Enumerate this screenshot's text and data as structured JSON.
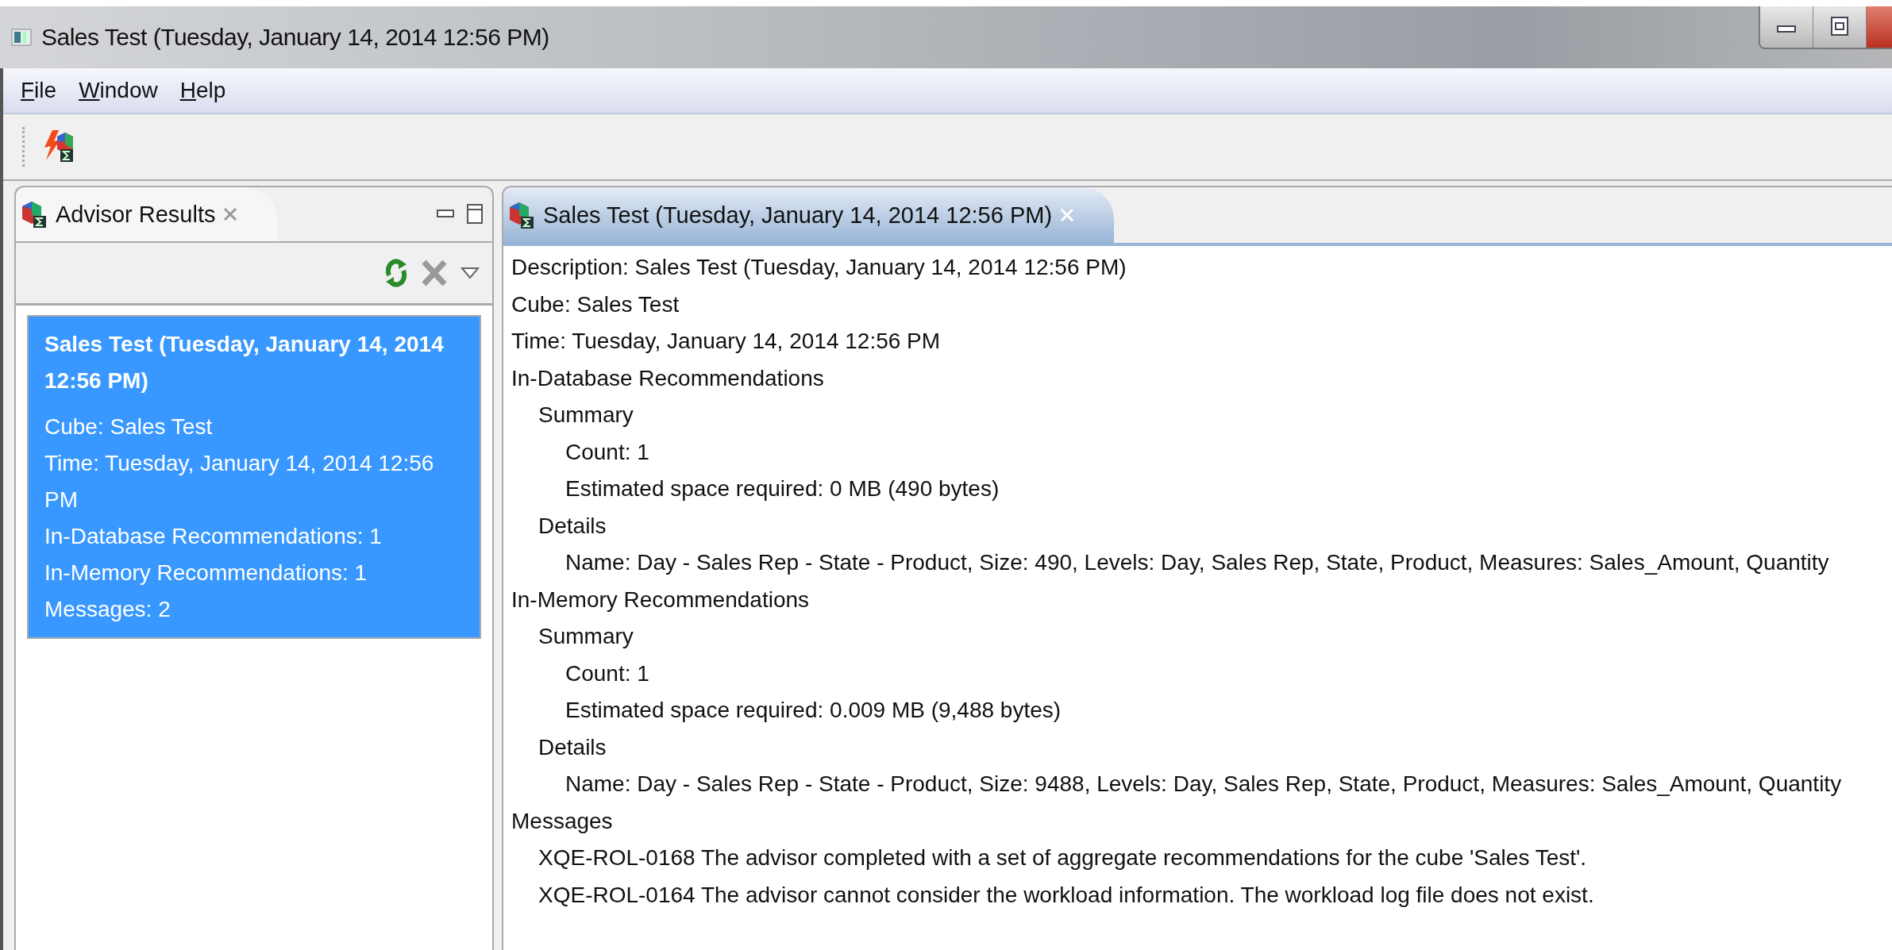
{
  "window": {
    "title": "Sales Test (Tuesday, January 14, 2014 12:56 PM)"
  },
  "menu": [
    {
      "label": "File"
    },
    {
      "label": "Window"
    },
    {
      "label": "Help"
    }
  ],
  "left_panel": {
    "tab": {
      "label": "Advisor Results",
      "selected": false
    },
    "results": [
      {
        "title": "Sales Test (Tuesday, January 14, 2014 12:56 PM)",
        "selected": true,
        "lines": [
          "Cube: Sales Test",
          "Time: Tuesday, January 14, 2014 12:56 PM",
          "In-Database Recommendations: 1",
          "In-Memory Recommendations: 1",
          "Messages: 2"
        ]
      }
    ]
  },
  "editor": {
    "tab": {
      "label": "Sales Test (Tuesday, January 14, 2014 12:56 PM)",
      "selected": true
    },
    "details": [
      {
        "text": "Description: Sales Test (Tuesday, January 14, 2014 12:56 PM)"
      },
      {
        "text": "Cube: Sales Test"
      },
      {
        "text": "Time: Tuesday, January 14, 2014 12:56 PM"
      },
      {
        "text": "In-Database Recommendations",
        "children": [
          {
            "text": "Summary",
            "children": [
              {
                "text": "Count: 1"
              },
              {
                "text": "Estimated space required: 0 MB (490 bytes)"
              }
            ]
          },
          {
            "text": "Details",
            "children": [
              {
                "text": "Name: Day - Sales Rep - State - Product, Size: 490, Levels: Day, Sales Rep, State, Product, Measures: Sales_Amount, Quantity"
              }
            ]
          }
        ]
      },
      {
        "text": "In-Memory Recommendations",
        "children": [
          {
            "text": "Summary",
            "children": [
              {
                "text": "Count: 1"
              },
              {
                "text": "Estimated space required: 0.009 MB (9,488 bytes)"
              }
            ]
          },
          {
            "text": "Details",
            "children": [
              {
                "text": "Name: Day - Sales Rep - State - Product, Size: 9488, Levels: Day, Sales Rep, State, Product, Measures: Sales_Amount, Quantity"
              }
            ]
          }
        ]
      },
      {
        "text": "Messages",
        "children": [
          {
            "text": "XQE-ROL-0168 The advisor completed with a set of aggregate recommendations for the cube 'Sales Test'."
          },
          {
            "text": "XQE-ROL-0164 The advisor cannot consider the workload information. The workload log file does not exist."
          }
        ]
      }
    ]
  }
}
